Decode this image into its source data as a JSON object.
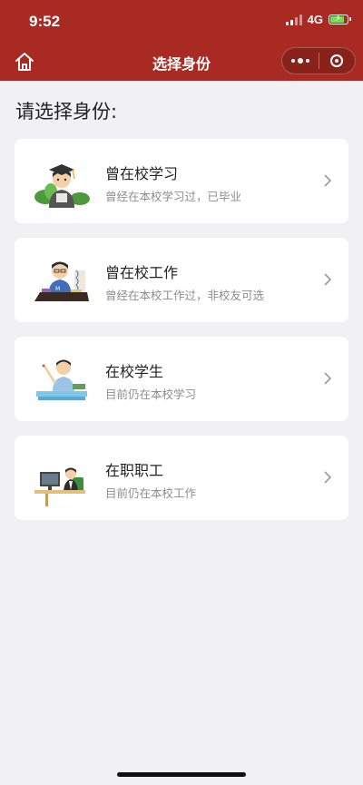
{
  "status_bar": {
    "time": "9:52",
    "network": "4G"
  },
  "nav": {
    "title": "选择身份"
  },
  "heading": "请选择身份:",
  "options": [
    {
      "title": "曾在校学习",
      "subtitle": "曾经在本校学习过，已毕业",
      "icon": "graduate-illustration"
    },
    {
      "title": "曾在校工作",
      "subtitle": "曾经在本校工作过，非校友可选",
      "icon": "former-staff-illustration"
    },
    {
      "title": "在校学生",
      "subtitle": "目前仍在本校学习",
      "icon": "student-illustration"
    },
    {
      "title": "在职职工",
      "subtitle": "目前仍在本校工作",
      "icon": "employee-illustration"
    }
  ],
  "colors": {
    "header": "#a82a22",
    "background": "#f1f1f4",
    "card": "#ffffff"
  }
}
